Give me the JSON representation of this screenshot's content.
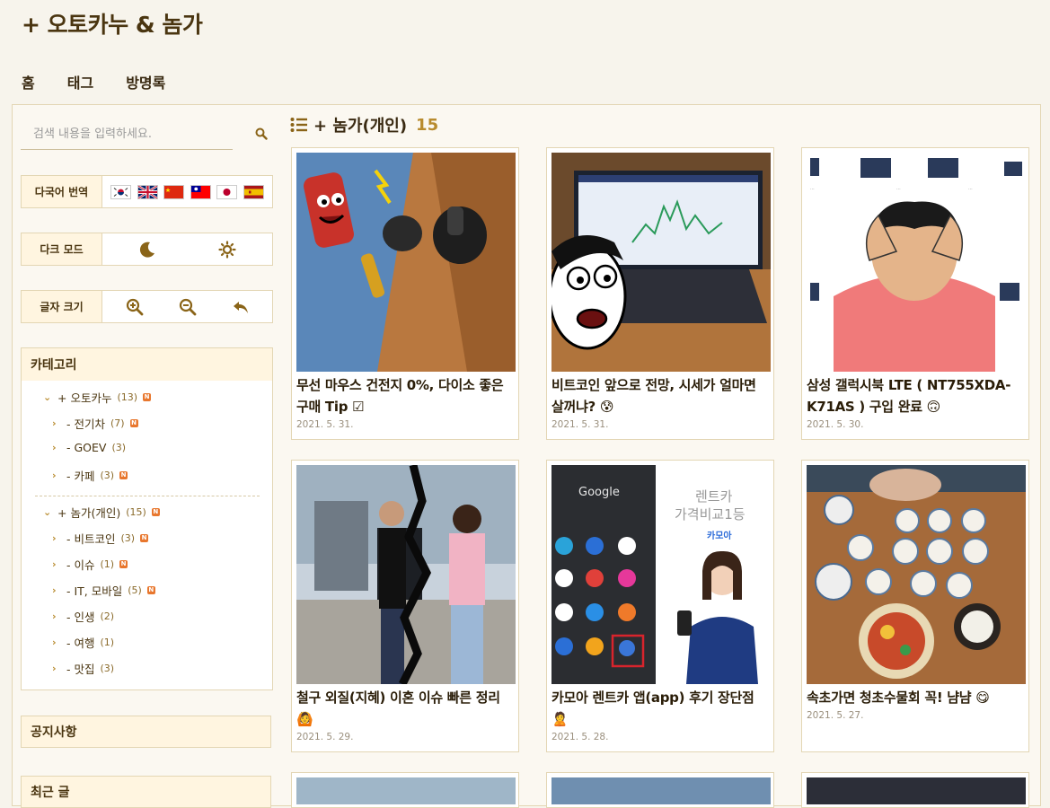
{
  "site": {
    "title": "+ 오토카누 & 놈가"
  },
  "nav": [
    "홈",
    "태그",
    "방명록"
  ],
  "search": {
    "placeholder": "검색 내용을 입력하세요."
  },
  "translate": {
    "label": "다국어 번역",
    "flags": [
      "korea-flag",
      "uk-flag",
      "china-flag",
      "taiwan-flag",
      "japan-flag",
      "spain-flag"
    ]
  },
  "darkmode": {
    "label": "다크 모드"
  },
  "fontsize": {
    "label": "글자 크기"
  },
  "category": {
    "title": "카테고리",
    "groups": [
      {
        "name": "+ 오토카누",
        "count": "(13)",
        "new": true,
        "items": [
          {
            "name": "- 전기차",
            "count": "(7)",
            "new": true
          },
          {
            "name": "- GOEV",
            "count": "(3)",
            "new": false
          },
          {
            "name": "- 카페",
            "count": "(3)",
            "new": true
          }
        ]
      },
      {
        "name": "+ 놈가(개인)",
        "count": "(15)",
        "new": true,
        "items": [
          {
            "name": "- 비트코인",
            "count": "(3)",
            "new": true
          },
          {
            "name": "- 이슈",
            "count": "(1)",
            "new": true
          },
          {
            "name": "- IT, 모바일",
            "count": "(5)",
            "new": true
          },
          {
            "name": "- 인생",
            "count": "(2)",
            "new": false
          },
          {
            "name": "- 여행",
            "count": "(1)",
            "new": false
          },
          {
            "name": "- 맛집",
            "count": "(3)",
            "new": false
          }
        ]
      }
    ]
  },
  "notice": {
    "title": "공지사항"
  },
  "recent": {
    "title": "최근 글"
  },
  "list": {
    "title": "+ 놈가(개인)",
    "count": "15"
  },
  "posts": [
    {
      "title": "무선 마우스 건전지 0%, 다이소 좋은 구매 Tip ☑",
      "date": "2021. 5. 31."
    },
    {
      "title": "비트코인 앞으로 전망, 시세가 얼마면 살꺼냐? 😰",
      "date": "2021. 5. 31."
    },
    {
      "title": "삼성 갤럭시북 LTE ( NT755XDA-K71AS ) 구입 완료 🙃",
      "date": "2021. 5. 30."
    },
    {
      "title": "철구 외질(지혜) 이혼 이슈 빠른 정리 🙆",
      "date": "2021. 5. 29."
    },
    {
      "title": "카모아 렌트카 앱(app) 후기 장단점 🙎",
      "date": "2021. 5. 28."
    },
    {
      "title": "속초가면 청초수물회 꼭! 냠냠 😋",
      "date": "2021. 5. 27."
    }
  ],
  "thumb_text": {
    "google": "Google",
    "rentcar": "렌트카",
    "compare": "가격비교1등",
    "camoa": "카모아"
  },
  "colors": {
    "accent": "#b88b2e",
    "panel": "#fff5e0",
    "border": "#e3d6b4",
    "new_badge": "#e8772e"
  }
}
